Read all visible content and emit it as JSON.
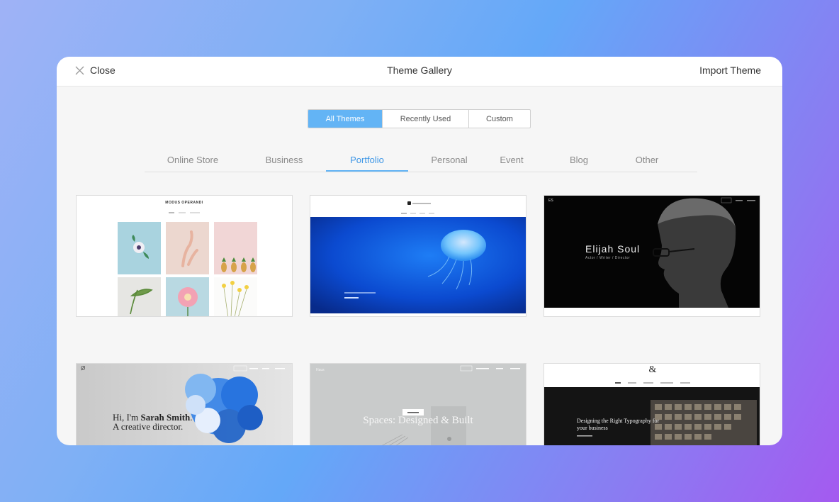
{
  "header": {
    "close_label": "Close",
    "title": "Theme Gallery",
    "import_label": "Import Theme"
  },
  "filters": {
    "segments": [
      "All Themes",
      "Recently Used",
      "Custom"
    ],
    "selected_segment": "All Themes"
  },
  "categories": {
    "items": [
      "Online Store",
      "Business",
      "Portfolio",
      "Personal",
      "Event",
      "Blog",
      "Other"
    ],
    "active": "Portfolio"
  },
  "themes": {
    "t1": {
      "brand": "MODUS OPERANDI"
    },
    "t3": {
      "name": "Elijah Soul",
      "tagline": "Actor / Writer / Director"
    },
    "t4": {
      "headline_a": "Hi, I'm ",
      "headline_name": "Sarah Smith",
      "headline_b": ". A creative director."
    },
    "t5": {
      "headline": "Spaces: Designed & Built"
    },
    "t6": {
      "logo": "&",
      "headline": "Designing the Right Typography for your business"
    }
  },
  "colors": {
    "accent": "#63b4f5",
    "active_tab_text": "#3e97e6"
  }
}
